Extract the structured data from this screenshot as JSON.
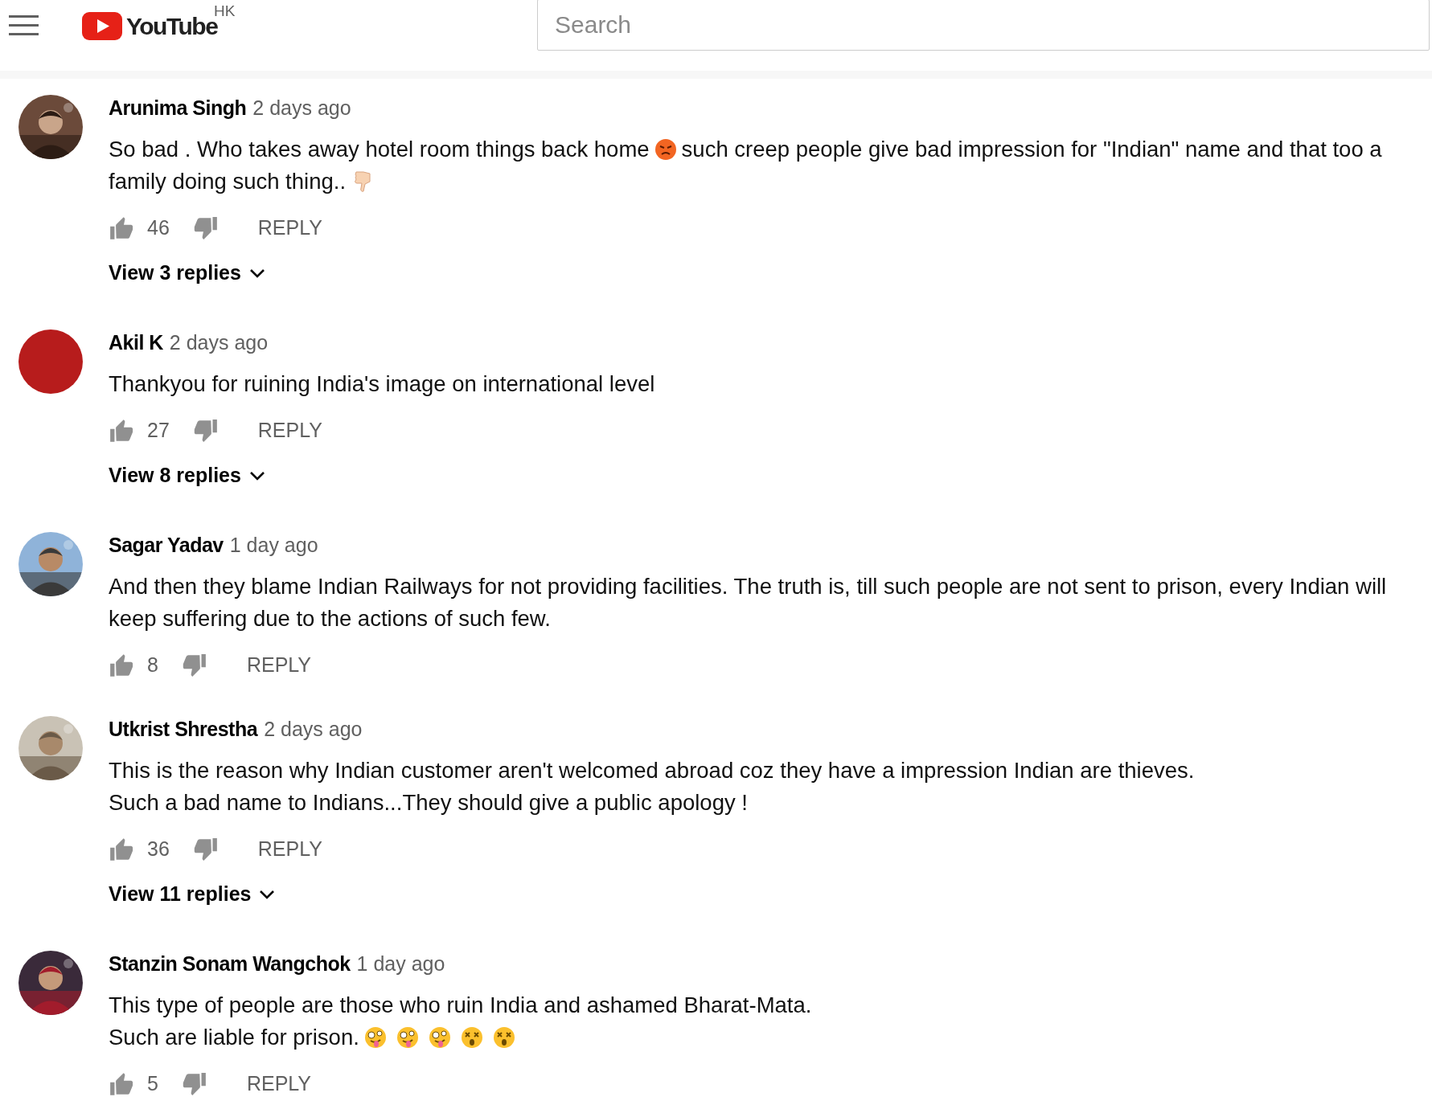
{
  "header": {
    "country": "HK",
    "logo_text": "YouTube",
    "search": {
      "placeholder": "Search"
    }
  },
  "comments": [
    {
      "author": "Arunima Singh",
      "time": "2 days ago",
      "lines": [
        [
          {
            "kind": "text",
            "text": "So bad . Who takes away hotel room things back home"
          },
          {
            "kind": "angry"
          },
          {
            "kind": "text",
            "text": "such creep people give bad impression for \"Indian\" name and that too a"
          }
        ],
        [
          {
            "kind": "text",
            "text": "family doing such thing.."
          },
          {
            "kind": "thumbsdown"
          }
        ]
      ],
      "likes": "46",
      "reply": "REPLY",
      "view_replies": "View 3 replies"
    },
    {
      "author": "Akil K",
      "time": "2 days ago",
      "lines": [
        [
          {
            "kind": "text",
            "text": "Thankyou for ruining India's image on international level"
          }
        ]
      ],
      "likes": "27",
      "reply": "REPLY",
      "view_replies": "View 8 replies"
    },
    {
      "author": "Sagar Yadav",
      "time": "1 day ago",
      "lines": [
        [
          {
            "kind": "text",
            "text": "And then they blame Indian Railways for not providing facilities. The truth is, till such people are not sent to prison, every Indian will"
          }
        ],
        [
          {
            "kind": "text",
            "text": "keep suffering due to the actions of such few."
          }
        ]
      ],
      "likes": "8",
      "reply": "REPLY"
    },
    {
      "author": "Utkrist Shrestha",
      "time": "2 days ago",
      "lines": [
        [
          {
            "kind": "text",
            "text": "This is the reason why Indian customer aren't welcomed abroad coz they have a impression Indian are thieves."
          }
        ],
        [
          {
            "kind": "text",
            "text": "Such a bad name to Indians...They should give a public apology !"
          }
        ]
      ],
      "likes": "36",
      "reply": "REPLY",
      "view_replies": "View 11 replies"
    },
    {
      "author": "Stanzin Sonam Wangchok",
      "time": "1 day ago",
      "lines": [
        [
          {
            "kind": "text",
            "text": "This type of people are those who ruin India and ashamed Bharat-Mata."
          }
        ],
        [
          {
            "kind": "text",
            "text": "Such are liable for prison."
          },
          {
            "kind": "zany"
          },
          {
            "kind": "zany"
          },
          {
            "kind": "zany"
          },
          {
            "kind": "dizzy"
          },
          {
            "kind": "dizzy"
          }
        ]
      ],
      "likes": "5",
      "reply": "REPLY"
    }
  ]
}
